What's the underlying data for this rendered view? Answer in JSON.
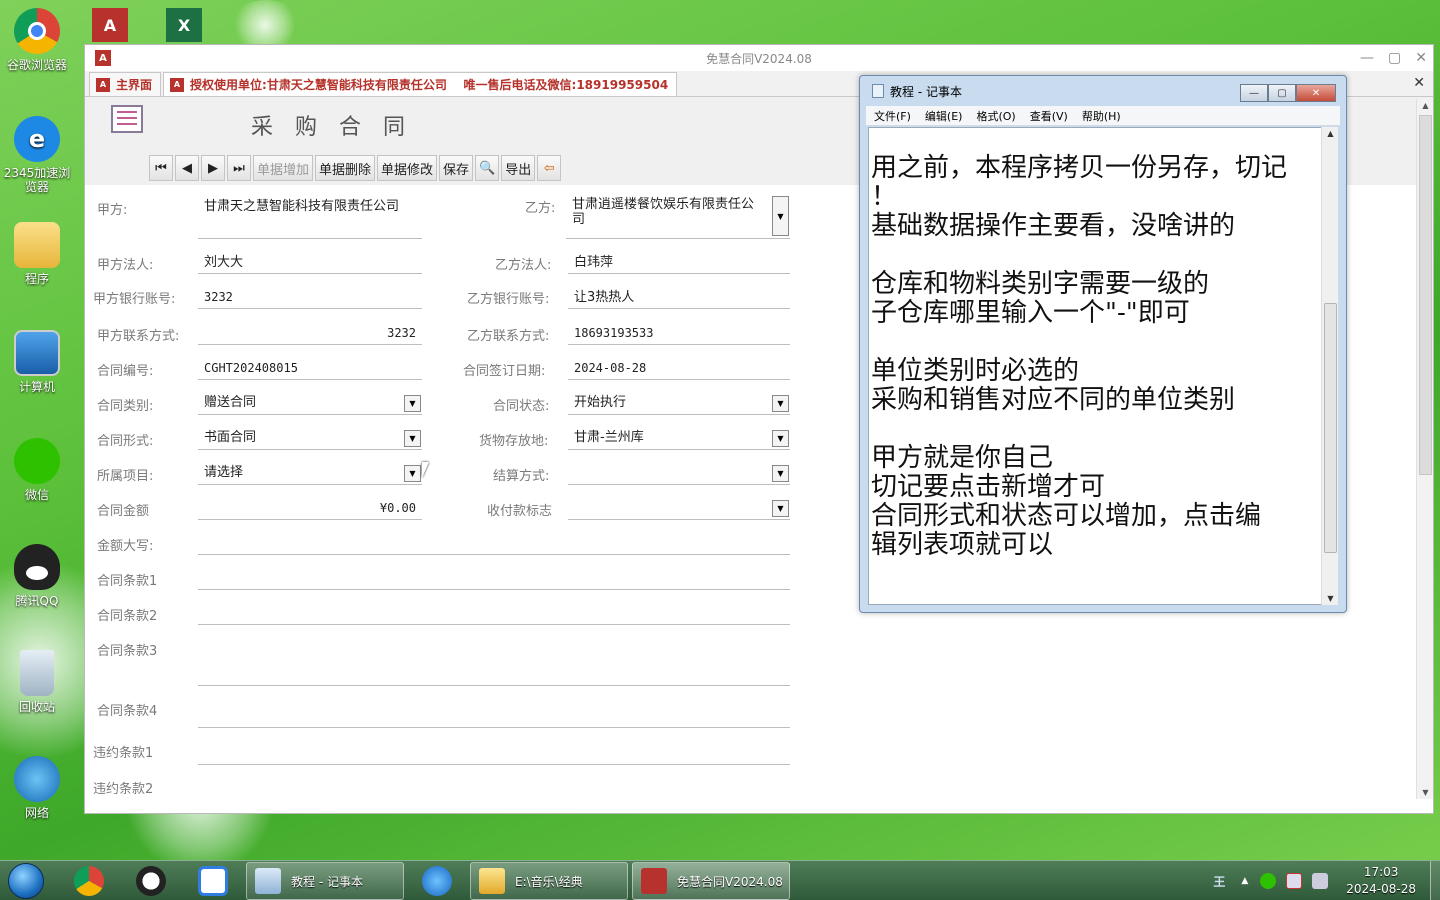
{
  "desktop": {
    "icons": [
      {
        "label": "谷歌浏览器"
      },
      {
        "label": "2345加速浏览器"
      },
      {
        "label": "程序"
      },
      {
        "label": "计算机"
      },
      {
        "label": "微信"
      },
      {
        "label": "腾讯QQ"
      },
      {
        "label": "回收站"
      },
      {
        "label": "网络"
      }
    ]
  },
  "access": {
    "window_title": "免慧合同V2024.08",
    "tabs": [
      {
        "label": "主界面"
      },
      {
        "label": "授权使用单位:甘肃天之慧智能科技有限责任公司    唯一售后电话及微信:18919959504"
      }
    ],
    "form_title": "采购合同",
    "toolbar": {
      "first": "⏮",
      "prev": "◀",
      "next": "▶",
      "last": "⏭",
      "add": "单据增加",
      "delete": "单据删除",
      "edit": "单据修改",
      "save": "保存",
      "preview": "🔍",
      "export": "导出",
      "exit": "⇦"
    },
    "fields": {
      "party_a_label": "甲方:",
      "party_a": "甘肃天之慧智能科技有限责任公司",
      "party_b_label": "乙方:",
      "party_b": "甘肃逍遥楼餐饮娱乐有限责任公司",
      "party_a_rep_label": "甲方法人:",
      "party_a_rep": "刘大大",
      "party_b_rep_label": "乙方法人:",
      "party_b_rep": "白玮萍",
      "party_a_bank_label": "甲方银行账号:",
      "party_a_bank": "3232",
      "party_b_bank_label": "乙方银行账号:",
      "party_b_bank": "让3热热人",
      "party_a_contact_label": "甲方联系方式:",
      "party_a_contact": "3232",
      "party_b_contact_label": "乙方联系方式:",
      "party_b_contact": "18693193533",
      "contract_no_label": "合同编号:",
      "contract_no": "CGHT202408015",
      "sign_date_label": "合同签订日期:",
      "sign_date": "2024-08-28",
      "contract_type_label": "合同类别:",
      "contract_type": "赠送合同",
      "contract_status_label": "合同状态:",
      "contract_status": "开始执行",
      "contract_form_label": "合同形式:",
      "contract_form": "书面合同",
      "storage_label": "货物存放地:",
      "storage": "甘肃-兰州库",
      "project_label": "所属项目:",
      "project": "请选择",
      "settlement_label": "结算方式:",
      "settlement": "",
      "amount_label": "合同金额",
      "amount": "¥0.00",
      "payment_flag_label": "收付款标志",
      "payment_flag": "",
      "amount_upper_label": "金额大写:",
      "amount_upper": "",
      "clause1_label": "合同条款1",
      "clause2_label": "合同条款2",
      "clause3_label": "合同条款3",
      "clause4_label": "合同条款4",
      "breach1_label": "违约条款1",
      "breach2_label": "违约条款2"
    }
  },
  "notepad": {
    "title": "教程 - 记事本",
    "menu": [
      "文件(F)",
      "编辑(E)",
      "格式(O)",
      "查看(V)",
      "帮助(H)"
    ],
    "text": "用之前，本程序拷贝一份另存，切记\n！\n基础数据操作主要看，没啥讲的\n\n仓库和物料类别字需要一级的\n子仓库哪里输入一个\"-\"即可\n\n单位类别时必选的\n采购和销售对应不同的单位类别\n\n甲方就是你自己\n切记要点击新增才可\n合同形式和状态可以增加，点击编\n辑列表项就可以"
  },
  "taskbar": {
    "tasks": [
      {
        "label": "教程 - 记事本"
      },
      {
        "label": "E:\\音乐\\经典"
      },
      {
        "label": "免慧合同V2024.08"
      }
    ],
    "ime": "王",
    "time": "17:03",
    "date": "2024-08-28"
  }
}
